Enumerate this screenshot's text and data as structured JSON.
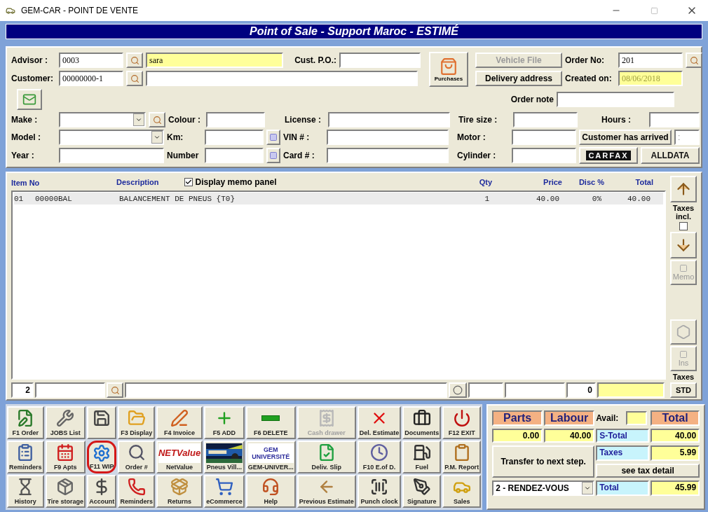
{
  "window": {
    "title": "GEM-CAR - POINT DE VENTE"
  },
  "banner": "Point of Sale - Support Maroc - ESTIMÉ",
  "header": {
    "advisor": {
      "label": "Advisor :",
      "code": "0003",
      "name": "sara"
    },
    "cust_po": {
      "label": "Cust. P.O.:"
    },
    "customer": {
      "label": "Customer:",
      "code": "00000000-1"
    },
    "purchases_button": "Purchases",
    "vehicle_file_button": {
      "label": "Vehicle File",
      "disabled": true
    },
    "delivery_address_button": {
      "label": "Delivery address",
      "disabled": false
    },
    "order_no": {
      "label": "Order No:",
      "value": "201"
    },
    "created_on": {
      "label": "Created on:",
      "value": "08/06/2018"
    },
    "order_note": {
      "label": "Order note"
    }
  },
  "vehicle": {
    "make": "Make :",
    "model": "Model :",
    "year": "Year :",
    "colour": "Colour :",
    "km": "Km:",
    "number": "Number",
    "license": "License :",
    "vin": "VIN # :",
    "card": "Card # :",
    "tire_size": "Tire size :",
    "motor": "Motor :",
    "cylinder": "Cylinder :",
    "hours": "Hours :",
    "arrived_button": "Customer has arrived",
    "arrived_time": ":",
    "carfax_logo": "CARFAX",
    "alldata_logo": "ALLDATA"
  },
  "table": {
    "columns": [
      {
        "label": "Item No"
      },
      {
        "label": "Description"
      },
      {
        "label": "Qty"
      },
      {
        "label": "Price"
      },
      {
        "label": "Disc %"
      },
      {
        "label": "Total"
      }
    ],
    "memo_panel": {
      "label": "Display memo panel",
      "checked": true
    },
    "rows": [
      {
        "line": "01",
        "item": "00000BAL",
        "description": "BALANCEMENT DE PNEUS {T0}",
        "qty": "1",
        "price": "40.00",
        "disc": "0%",
        "total": "40.00",
        "selected": true
      }
    ]
  },
  "side": {
    "taxes_incl_label": "Taxes incl.",
    "taxes_incl_checked": false,
    "memo_button": {
      "label": "Memo",
      "disabled": true
    },
    "ins_button": {
      "label": "Ins",
      "disabled": true
    },
    "taxes_label": "Taxes",
    "std_button": "STD"
  },
  "entry": {
    "quantity": "2",
    "count": "0"
  },
  "buttons": [
    {
      "label": "F1 Order",
      "kind": "icon",
      "disabled": false,
      "highlighted": false
    },
    {
      "label": "JOBS List",
      "kind": "icon",
      "disabled": false,
      "highlighted": false
    },
    {
      "kind": "icon",
      "disabled": false,
      "highlighted": false
    },
    {
      "label": "F3 Display",
      "kind": "icon",
      "disabled": false,
      "highlighted": false
    },
    {
      "label": "F4 Invoice",
      "kind": "icon",
      "disabled": false,
      "highlighted": false
    },
    {
      "label": "F5 ADD",
      "kind": "icon",
      "disabled": false,
      "highlighted": false
    },
    {
      "label": "F6 DELETE",
      "kind": "icon",
      "disabled": false,
      "highlighted": false
    },
    {
      "label": "Cash drawer",
      "kind": "icon",
      "disabled": true,
      "highlighted": false
    },
    {
      "label": "Del. Estimate",
      "kind": "icon",
      "disabled": false,
      "highlighted": false
    },
    {
      "label": "Documents",
      "kind": "icon",
      "disabled": false,
      "highlighted": false
    },
    {
      "label": "F12 EXIT",
      "kind": "icon",
      "disabled": false,
      "highlighted": false
    },
    {
      "label": "Reminders",
      "kind": "icon",
      "disabled": false,
      "highlighted": false
    },
    {
      "label": "F9 Apts",
      "kind": "icon",
      "disabled": false,
      "highlighted": false
    },
    {
      "label": "F11 WIP",
      "kind": "icon",
      "disabled": false,
      "highlighted": true
    },
    {
      "label": "Order #",
      "kind": "icon",
      "disabled": false,
      "highlighted": false
    },
    {
      "label": "NetValue",
      "kind": "logo",
      "logo_lines": [
        "NETValue"
      ],
      "disabled": false,
      "highlighted": false
    },
    {
      "label": "Pneus Vill...",
      "kind": "picture",
      "disabled": false,
      "highlighted": false
    },
    {
      "label": "GEM-UNIVER...",
      "kind": "logo",
      "logo_lines": [
        "GEM",
        "UNIVERSITÉ"
      ],
      "disabled": false,
      "highlighted": false
    },
    {
      "label": "Deliv. Slip",
      "kind": "icon",
      "disabled": false,
      "highlighted": false
    },
    {
      "label": "F10 E.of D.",
      "kind": "icon",
      "disabled": false,
      "highlighted": false
    },
    {
      "label": "Fuel",
      "kind": "icon",
      "disabled": false,
      "highlighted": false
    },
    {
      "label": "P.M. Report",
      "kind": "icon",
      "disabled": false,
      "highlighted": false
    },
    {
      "label": "History",
      "kind": "icon",
      "disabled": false,
      "highlighted": false
    },
    {
      "label": "Tire storage",
      "kind": "icon",
      "disabled": false,
      "highlighted": false
    },
    {
      "label": "Account",
      "kind": "icon",
      "disabled": false,
      "highlighted": false
    },
    {
      "label": "Reminders",
      "kind": "icon",
      "disabled": false,
      "highlighted": false
    },
    {
      "label": "Returns",
      "kind": "icon",
      "disabled": false,
      "highlighted": false
    },
    {
      "label": "eCommerce",
      "kind": "icon",
      "disabled": false,
      "highlighted": false
    },
    {
      "label": "Help",
      "kind": "icon",
      "disabled": false,
      "highlighted": false
    },
    {
      "label": "Previous Estimate",
      "kind": "icon",
      "disabled": false,
      "highlighted": false
    },
    {
      "label": "Punch clock",
      "kind": "icon",
      "disabled": false,
      "highlighted": false
    },
    {
      "label": "Signature",
      "kind": "icon",
      "disabled": false,
      "highlighted": false
    },
    {
      "label": "Sales",
      "kind": "icon",
      "disabled": false,
      "highlighted": false
    }
  ],
  "totals": {
    "parts": {
      "label": "Parts",
      "value": "0.00"
    },
    "labour": {
      "label": "Labour",
      "value": "40.00"
    },
    "avail_label": "Avail:",
    "total_label": "Total",
    "lines": [
      {
        "label": "S-Total",
        "value": "40.00"
      },
      {
        "label": "Taxes",
        "value": "5.99"
      },
      {
        "label": "Total",
        "value": "45.99"
      }
    ],
    "transfer_button": "Transfer to next step.",
    "step_select": "2 - RENDEZ-VOUS",
    "tax_detail_button": "see tax detail"
  }
}
